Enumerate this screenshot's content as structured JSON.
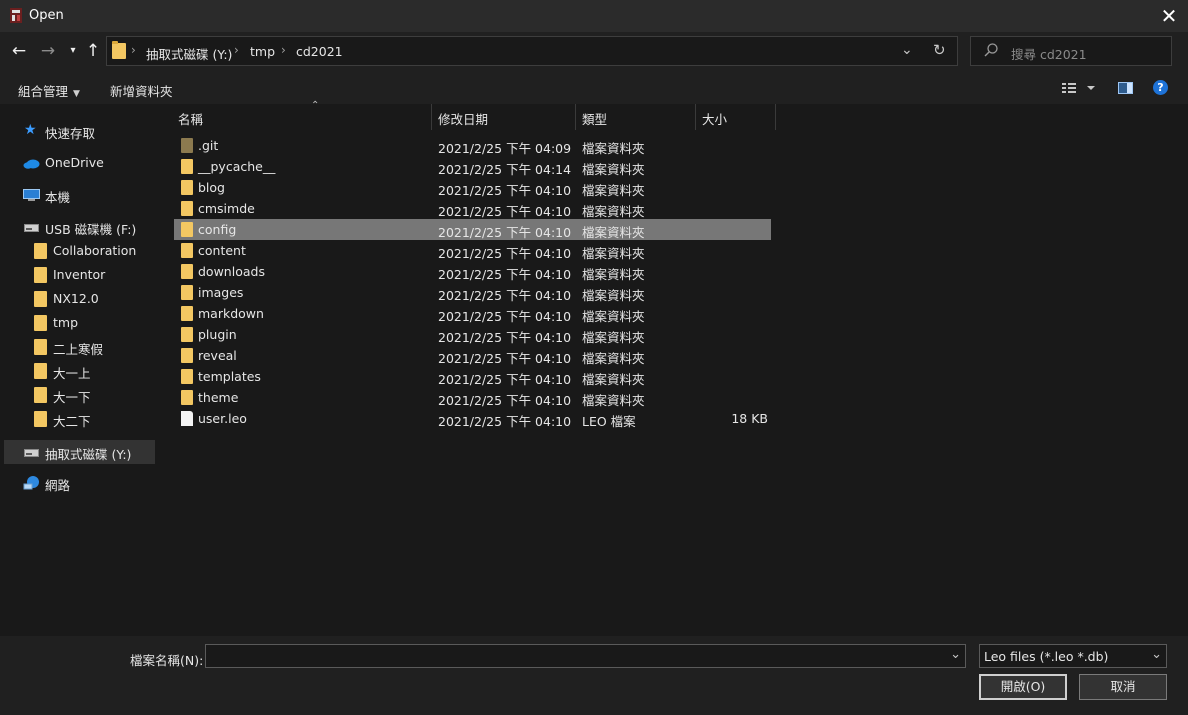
{
  "window": {
    "title": "Open"
  },
  "address": {
    "crumbs": [
      "抽取式磁碟 (Y:)",
      "tmp",
      "cd2021"
    ]
  },
  "search": {
    "placeholder": "搜尋 cd2021"
  },
  "toolbar": {
    "organize": "組合管理",
    "new_folder": "新增資料夾"
  },
  "sidebar": {
    "quick_access": "快速存取",
    "onedrive": "OneDrive",
    "this_pc": "本機",
    "usb_drive": "USB 磁碟機 (F:)",
    "usb_folders": [
      "Collaboration",
      "Inventor",
      "NX12.0",
      "tmp",
      "二上寒假",
      "大一上",
      "大一下",
      "大二下"
    ],
    "removable": "抽取式磁碟 (Y:)",
    "network": "網路"
  },
  "columns": {
    "name": "名稱",
    "date": "修改日期",
    "type": "類型",
    "size": "大小"
  },
  "files": [
    {
      "name": ".git",
      "date": "2021/2/25 下午 04:09",
      "type": "檔案資料夾",
      "size": ""
    },
    {
      "name": "__pycache__",
      "date": "2021/2/25 下午 04:14",
      "type": "檔案資料夾",
      "size": ""
    },
    {
      "name": "blog",
      "date": "2021/2/25 下午 04:10",
      "type": "檔案資料夾",
      "size": ""
    },
    {
      "name": "cmsimde",
      "date": "2021/2/25 下午 04:10",
      "type": "檔案資料夾",
      "size": ""
    },
    {
      "name": "config",
      "date": "2021/2/25 下午 04:10",
      "type": "檔案資料夾",
      "size": ""
    },
    {
      "name": "content",
      "date": "2021/2/25 下午 04:10",
      "type": "檔案資料夾",
      "size": ""
    },
    {
      "name": "downloads",
      "date": "2021/2/25 下午 04:10",
      "type": "檔案資料夾",
      "size": ""
    },
    {
      "name": "images",
      "date": "2021/2/25 下午 04:10",
      "type": "檔案資料夾",
      "size": ""
    },
    {
      "name": "markdown",
      "date": "2021/2/25 下午 04:10",
      "type": "檔案資料夾",
      "size": ""
    },
    {
      "name": "plugin",
      "date": "2021/2/25 下午 04:10",
      "type": "檔案資料夾",
      "size": ""
    },
    {
      "name": "reveal",
      "date": "2021/2/25 下午 04:10",
      "type": "檔案資料夾",
      "size": ""
    },
    {
      "name": "templates",
      "date": "2021/2/25 下午 04:10",
      "type": "檔案資料夾",
      "size": ""
    },
    {
      "name": "theme",
      "date": "2021/2/25 下午 04:10",
      "type": "檔案資料夾",
      "size": ""
    },
    {
      "name": "user.leo",
      "date": "2021/2/25 下午 04:10",
      "type": "LEO 檔案",
      "size": "18 KB"
    }
  ],
  "selected_file": "config",
  "footer": {
    "filename_label": "檔案名稱(N):",
    "filename_value": "",
    "filter": "Leo files (*.leo *.db)",
    "open": "開啟(O)",
    "cancel": "取消"
  }
}
